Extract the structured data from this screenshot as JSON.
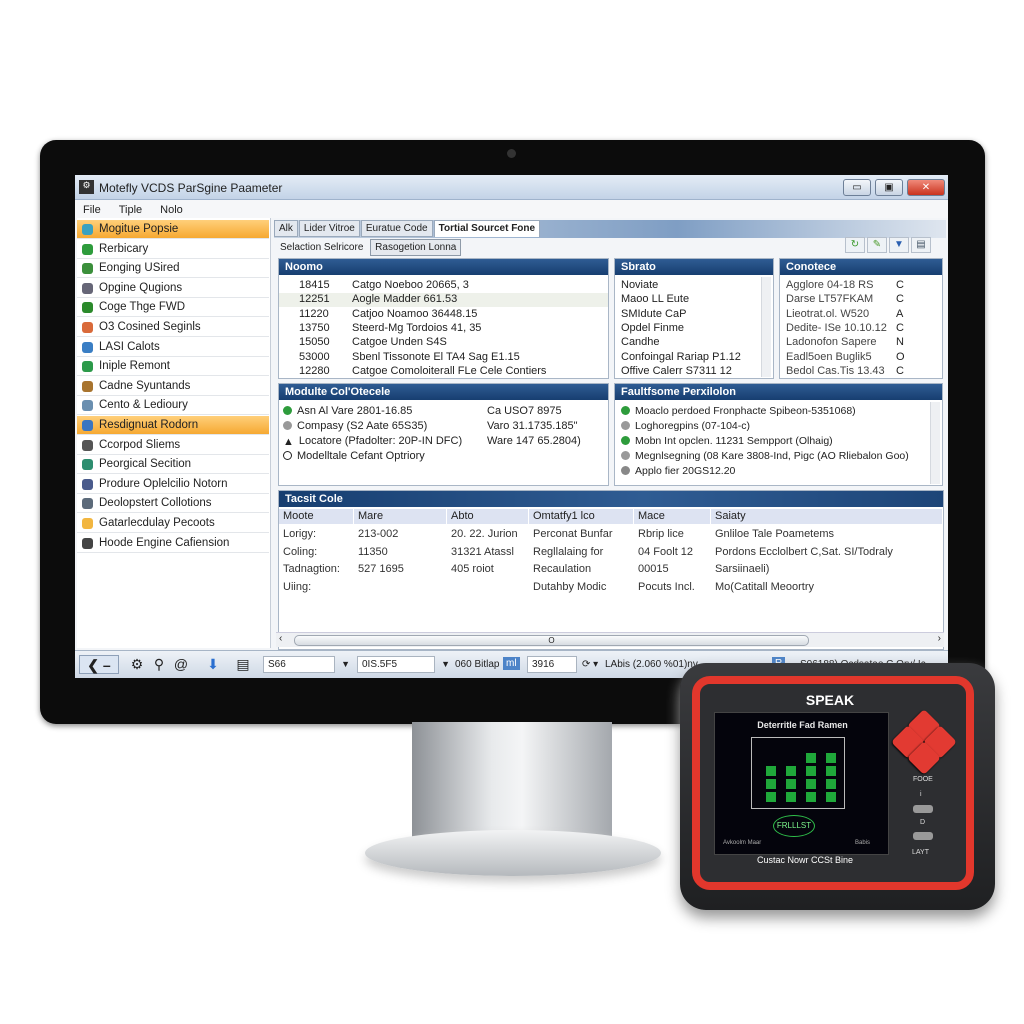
{
  "window": {
    "title": "Motefly VCDS ParSgine Paameter",
    "min": "▭",
    "max": "▣",
    "close": "✕"
  },
  "menu": [
    "File",
    "Tiple",
    "Nolo"
  ],
  "sidebar": {
    "items": [
      {
        "label": "Mogitue Popsie",
        "color": "#3aa1c0",
        "selected": true
      },
      {
        "label": "Rerbicary",
        "color": "#2e9c3c"
      },
      {
        "label": "Eonging USired",
        "color": "#3b8f3b"
      },
      {
        "label": "Opgine Qugions",
        "color": "#667"
      },
      {
        "label": "Coge Thge FWD",
        "color": "#2b8a2b"
      },
      {
        "label": "O3 Cosined Seginls",
        "color": "#d96a3a"
      },
      {
        "label": "LASI Calots",
        "color": "#3a7ec4"
      },
      {
        "label": "Iniple Remont",
        "color": "#2c9a4a"
      },
      {
        "label": "Cadne Syuntands",
        "color": "#a8742e"
      },
      {
        "label": "Cento & Ledioury",
        "color": "#6a8fb0"
      },
      {
        "label": "Resdignuat Rodorn",
        "color": "#3a75c0",
        "selected": true
      },
      {
        "label": "Ccorpod Sliems",
        "color": "#555"
      },
      {
        "label": "Peorgical Secition",
        "color": "#2d8d6f"
      },
      {
        "label": "Produre Oplelcilio Notorn",
        "color": "#4a5b8c"
      },
      {
        "label": "Deolopstert Collotions",
        "color": "#5c6a7a"
      },
      {
        "label": "Gatarlecdulay Pecoots",
        "color": "#f2b640"
      },
      {
        "label": "Hoode Engine Cafiension",
        "color": "#444"
      }
    ]
  },
  "tabs": [
    {
      "label": "Alk"
    },
    {
      "label": "Lider Vitroe"
    },
    {
      "label": "Euratue Code"
    },
    {
      "label": "Tortial Sourcet Fone",
      "active": true
    }
  ],
  "subtabs": [
    "Selaction Selricore",
    "Rasogetion Lonna"
  ],
  "toolbar_icons": [
    "refresh-icon",
    "tool-icon",
    "filter-icon",
    "save-icon"
  ],
  "name_panel": {
    "title": "Noomo",
    "rows": [
      [
        "18415",
        "Catgo Noeboo 20665, 3"
      ],
      [
        "12251",
        "Aogle Madder 661.53"
      ],
      [
        "11220",
        "Catjoo Noamoo 36448.15"
      ],
      [
        "13750",
        "Steerd-Mg Tordoios 41, 35"
      ],
      [
        "15050",
        "Catgoe Unden S4S"
      ],
      [
        "53000",
        "Sbenl Tissonote El TA4 Sag E1.15"
      ],
      [
        "12280",
        "Catgoe Comoloiterall FLe Cele Contiers"
      ]
    ]
  },
  "status_panel": {
    "title": "Sbrato",
    "rows": [
      "Noviate",
      "Maoo LL Eute",
      "SMIdute CaP",
      "Opdel Finme",
      "Candhe",
      "Confoingal Rariap P1.12",
      "Offive Calerr S7311 12"
    ]
  },
  "cont_panel": {
    "title": "Conotece",
    "rows": [
      [
        "Agglore 04-18 RS",
        "C"
      ],
      [
        "Darse LT57FKAM",
        "C"
      ],
      [
        "Lieotrat.ol. W520",
        "A"
      ],
      [
        "Dedite- ISe 10.10.12",
        "C"
      ],
      [
        "Ladonofon Sapere",
        "N"
      ],
      [
        "Eadl5oen Buglik5",
        "O"
      ],
      [
        "Bedol Cas.Tis 13.43",
        "C"
      ]
    ]
  },
  "module_panel": {
    "title": "Modulte Col'Otecele",
    "rows": [
      {
        "text": "Asn Al Vare 2801-16.85",
        "icon": "check-circle-icon",
        "color": "#2e9c3c"
      },
      {
        "text": "Compasy (S2 Aate 65S35)",
        "icon": "dot-icon",
        "color": "#999"
      },
      {
        "text": "Locatore (Pfadolter: 20P-IN DFC)",
        "icon": "warning-icon",
        "color": "#222"
      },
      {
        "text": "Modelltale Cefant Optriory",
        "icon": "circle-icon",
        "color": "#fff"
      }
    ],
    "right": [
      "Ca USO7 8975",
      "Varo  31.1735.185\"",
      "Ware 147 65.2804)"
    ]
  },
  "fault_panel": {
    "title": "Faultfsome Perxilolon",
    "rows": [
      {
        "text": "Moaclo perdoed Fronphacte Spibeon-5351068)",
        "color": "#2e9c3c"
      },
      {
        "text": "Loghoregpins (07-104-c)",
        "color": "#999"
      },
      {
        "text": "Mobn Int opclen. 11231 Sempport (Olhaig)",
        "color": "#2e9c3c"
      },
      {
        "text": "Megnlsegning (08 Kare 3808-Ind, Pigc (AO Rliebalon Goo)",
        "color": "#999"
      },
      {
        "text": "Applo fier 20GS12.20",
        "color": "#888"
      }
    ]
  },
  "table": {
    "title": "Tacsit Cole",
    "headers": [
      "Moote",
      "Mare",
      "Abto",
      "Omtatfy1 lco",
      "Mace",
      "Saiaty"
    ],
    "rows": [
      [
        "Lorigy:",
        "213-002",
        "20. 22. Jurion",
        "Perconat Bunfar",
        "Rbrip lice",
        "Gnliloe Tale Poametems"
      ],
      [
        "Coling:",
        "11350",
        "31321 Atassl",
        "Regllalaing for",
        "04 Foolt 12",
        "Pordons Ecclolbert C,Sat. SI/Todraly"
      ],
      [
        "Tadnagtion:",
        "527 1695",
        "405 roiot",
        "Recaulation",
        "00015",
        "Sarsiinaeli)"
      ],
      [
        "Uiing:",
        "",
        "",
        "Dutahby Modic",
        "Pocuts Incl.",
        "Mo(Catitall Meoortry"
      ]
    ],
    "scroll_label": "O"
  },
  "bottombar": {
    "combo1": "S66",
    "combo2": "0IS.5F5",
    "text1": "060 Bitlap",
    "badge": "ml",
    "spin": "3916",
    "text2": "LAbis  (2.060 %01)nv",
    "badge2": "R",
    "text3": "S06188)  Ocdsatae C Ory/ Ic"
  },
  "scanner": {
    "brand": "SPEAK",
    "screen_title": "Deterritle Fad Ramen",
    "logo": "FRLLLST",
    "screen_foot_left": "Avkoolm Maar",
    "screen_foot_right": "Babis",
    "label": "Custac Nowr CCSt Bine",
    "btn1": "FOOE",
    "btn2": "i",
    "btn3": "D",
    "btn4": "LAYT",
    "bars": [
      [
        0,
        2,
        3
      ],
      [
        0,
        2,
        3
      ],
      [
        3,
        4
      ],
      [
        4,
        4
      ]
    ]
  },
  "colors": {
    "accent_orange": "#f6a932",
    "header_blue": "#1f4a80",
    "scanner_red": "#e2372c",
    "lcd_green": "#1fa83a"
  }
}
